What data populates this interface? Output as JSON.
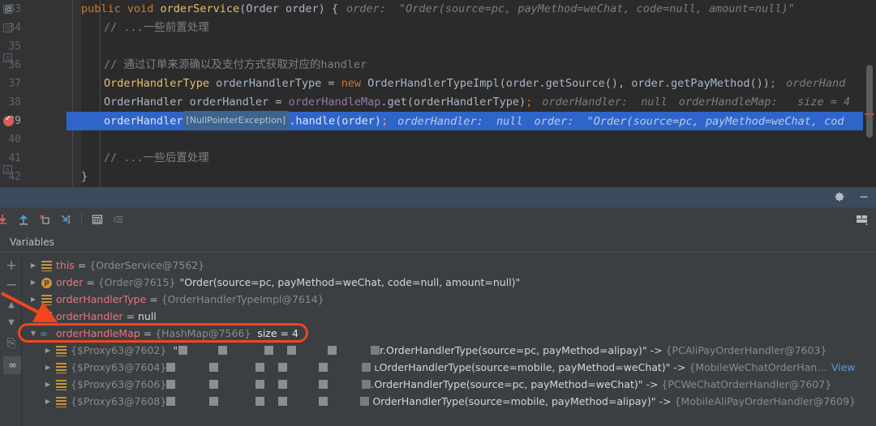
{
  "editor": {
    "lines": [
      {
        "num": "33",
        "marker": "@",
        "fold": "collapse-down"
      },
      {
        "num": "34",
        "fold": "collapse-down"
      },
      {
        "num": "35"
      },
      {
        "num": "36",
        "fold": "collapse-up"
      },
      {
        "num": "37"
      },
      {
        "num": "38"
      },
      {
        "num": "39",
        "breakpoint": true,
        "highlighted": true
      },
      {
        "num": "40"
      },
      {
        "num": "41"
      },
      {
        "num": "42",
        "fold": "collapse-up"
      }
    ],
    "code": {
      "l33_kw": "public void ",
      "l33_name": "orderService",
      "l33_sig": "(Order order) {",
      "l33_hint": "order:  \"Order(source=pc, payMethod=weChat, code=null, amount=null)\"",
      "l34_comment": "// ...一些前置处理",
      "l36_comment": "// 通过订单来源确以及支付方式获取对应的handler",
      "l37_type": "OrderHandlerType",
      "l37_var": " orderHandlerType = ",
      "l37_new": "new",
      "l37_rest": " OrderHandlerTypeImpl(order.getSource(), order.getPayMethod())",
      "l37_semi": ";",
      "l37_hint": "orderHand",
      "l38_a": "OrderHandler orderHandler = ",
      "l38_field": "orderHandleMap",
      "l38_b": ".get(orderHandlerType)",
      "l38_semi": ";",
      "l38_hint1": "orderHandler:  null",
      "l38_hint2": "orderHandleMap:   size = 4",
      "l39_a": "orderHandler",
      "l39_badge": "[NullPointerException]",
      "l39_b": ".handle(order)",
      "l39_semi": ";",
      "l39_hint1": "orderHandler:  null",
      "l39_hint2": "order:  \"Order(source=pc, payMethod=weChat, cod",
      "l41_comment": "// ...一些后置处理",
      "l42_brace": "}"
    }
  },
  "debug": {
    "header_icons": [
      {
        "name": "settings-gear-icon"
      },
      {
        "name": "minimize-icon"
      }
    ],
    "toolbar_icons": [
      {
        "name": "step-over-icon"
      },
      {
        "name": "step-into-icon"
      },
      {
        "name": "force-step-into-icon"
      },
      {
        "name": "step-out-icon"
      },
      {
        "name": "evaluate-expression-icon"
      },
      {
        "name": "show-execution-point-icon"
      }
    ],
    "toolbar_right_icon": "layout-settings-icon",
    "tab_label": "Variables",
    "side_buttons": [
      {
        "name": "add-watch-button",
        "glyph": "+"
      },
      {
        "name": "remove-watch-button",
        "glyph": "−"
      },
      {
        "name": "move-up-button",
        "glyph": "▲"
      },
      {
        "name": "move-down-button",
        "glyph": "▼"
      },
      {
        "name": "copy-value-button",
        "glyph": "⎘"
      },
      {
        "name": "watches-toggle-button",
        "glyph": "∞"
      }
    ],
    "variables": [
      {
        "indent": 0,
        "expander": "▶",
        "icon": "bars",
        "name": "this",
        "eq": " = ",
        "ref": "{OrderService@7562}",
        "value": ""
      },
      {
        "indent": 0,
        "expander": "▶",
        "icon": "param",
        "icon_glyph": "p",
        "name": "order",
        "eq": " = ",
        "ref": "{Order@7615}",
        "value": "\"Order(source=pc, payMethod=weChat, code=null, amount=null)\""
      },
      {
        "indent": 0,
        "expander": "▶",
        "icon": "bars",
        "name": "orderHandlerType",
        "eq": " = ",
        "ref": "{OrderHandlerTypeImpl@7614}",
        "value": ""
      },
      {
        "indent": 0,
        "expander": "",
        "icon": "bars",
        "name": "orderHandler",
        "eq": " = ",
        "ref": "",
        "value": "null"
      },
      {
        "indent": 0,
        "expander": "▼",
        "icon": "watch",
        "icon_glyph": "∞",
        "name": "orderHandleMap",
        "eq": " = ",
        "ref": "{HashMap@7566}",
        "value": "",
        "size": "size = 4",
        "highlighted_annotation": true
      },
      {
        "indent": 1,
        "expander": "▶",
        "icon": "bars",
        "name": "",
        "ref": "{$Proxy63@7602}",
        "redacted": true,
        "tail_prefix": "r.",
        "tail": "OrderHandlerType(source=pc, payMethod=alipay)\" -> ",
        "tail_ref": "{PCAliPayOrderHandler@7603}"
      },
      {
        "indent": 1,
        "expander": "▶",
        "icon": "bars",
        "name": "",
        "ref": "{$Proxy63@7604}",
        "redacted": true,
        "tail_prefix": "ʟ",
        "tail": "OrderHandlerType(source=mobile, payMethod=weChat)\" -> ",
        "tail_ref": "{MobileWeChatOrderHan…",
        "link": "View"
      },
      {
        "indent": 1,
        "expander": "▶",
        "icon": "bars",
        "name": "",
        "ref": "{$Proxy63@7606}",
        "redacted": true,
        "tail_prefix": ".",
        "tail": "OrderHandlerType(source=pc, payMethod=weChat)\" -> ",
        "tail_ref": "{PCWeChatOrderHandler@7607}"
      },
      {
        "indent": 1,
        "expander": "▶",
        "icon": "bars",
        "name": "",
        "ref": "{$Proxy63@7608}",
        "redacted": true,
        "tail_prefix": "",
        "tail": "OrderHandlerType(source=mobile, payMethod=alipay)\" -> ",
        "tail_ref": "{MobileAliPayOrderHandler@7609}"
      }
    ]
  },
  "annotations": {
    "arrow_color": "#f4451e",
    "ellipse_color": "#f4451e",
    "ellipse_target": "orderHandleMap",
    "arrow_target": "orderHandler"
  },
  "colors": {
    "editor_bg": "#2b2b2b",
    "gutter_bg": "#313335",
    "panel_bg": "#3c3f41",
    "selection_blue": "#2f65ca",
    "header_blue": "#3c4b5c",
    "var_name_red": "#e8757b",
    "keyword_orange": "#cc7832",
    "field_purple": "#9876aa",
    "type_yellow": "#e8bf6a"
  }
}
